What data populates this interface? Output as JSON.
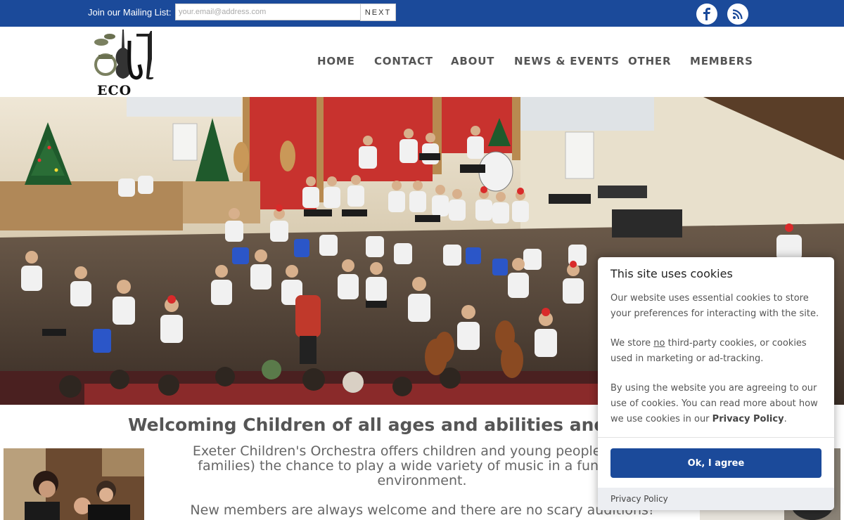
{
  "topbar": {
    "mailing_label": "Join our Mailing List:",
    "email_placeholder": "your.email@address.com",
    "next_label": "NEXT",
    "social": [
      "facebook-icon",
      "rss-icon"
    ]
  },
  "logo": {
    "text": "ECO"
  },
  "nav": {
    "items": [
      "HOME",
      "CONTACT",
      "ABOUT",
      "NEWS & EVENTS",
      "OTHER",
      "MEMBERS"
    ]
  },
  "main": {
    "heading": "Welcoming Children of all ages and abilities and t",
    "intro_line1": "Exeter Children's Orchestra offers children and young people aged 7",
    "intro_line2": "families) the chance to play a wide variety of music in a fun, friend",
    "intro_line3": "environment.",
    "intro_line4": "New members are always welcome and there are no scary auditions!"
  },
  "cookie": {
    "title": "This site uses cookies",
    "p1": "Our website uses essential cookies to store your preferences for interacting with the site.",
    "p2_before": "We store ",
    "p2_no": "no",
    "p2_after": " third-party cookies, or cookies used in marketing or ad-tracking.",
    "p3_before": "By using the website you are agreeing to our use of cookies. You can read more about how we use cookies in our ",
    "p3_link": "Privacy Policy",
    "p3_after": ".",
    "button": "Ok, I agree",
    "footer_link": "Privacy Policy"
  },
  "colors": {
    "brand": "#1b4a9a",
    "nav_text": "#555555",
    "curtain": "#c8322e"
  }
}
